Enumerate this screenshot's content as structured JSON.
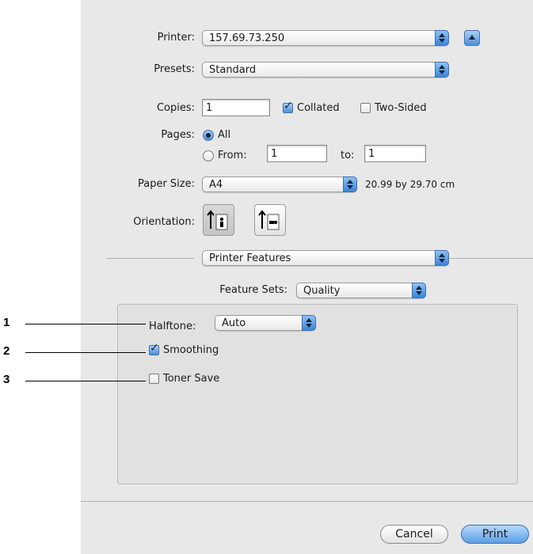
{
  "printer": {
    "label": "Printer:",
    "value": "157.69.73.250"
  },
  "presets": {
    "label": "Presets:",
    "value": "Standard"
  },
  "copies": {
    "label": "Copies:",
    "value": "1",
    "collated_label": "Collated",
    "collated_checked": true,
    "two_sided_label": "Two-Sided",
    "two_sided_checked": false
  },
  "pages": {
    "label": "Pages:",
    "all_label": "All",
    "from_label": "From:",
    "from_value": "1",
    "to_label": "to:",
    "to_value": "1",
    "selected": "All"
  },
  "paper_size": {
    "label": "Paper Size:",
    "value": "A4",
    "dimensions": "20.99 by 29.70 cm"
  },
  "orientation": {
    "label": "Orientation:",
    "options": [
      "portrait-icon",
      "landscape-icon"
    ],
    "selected": "portrait"
  },
  "section_popup": {
    "value": "Printer Features"
  },
  "feature_sets": {
    "label": "Feature Sets:",
    "value": "Quality"
  },
  "halftone": {
    "label": "Halftone:",
    "value": "Auto"
  },
  "smoothing": {
    "label": "Smoothing",
    "checked": true
  },
  "toner_save": {
    "label": "Toner Save",
    "checked": false
  },
  "buttons": {
    "cancel": "Cancel",
    "print": "Print"
  },
  "callouts": [
    "1",
    "2",
    "3"
  ],
  "colors": {
    "accent": "#4d8fd8",
    "panel": "#e8e8e8"
  }
}
